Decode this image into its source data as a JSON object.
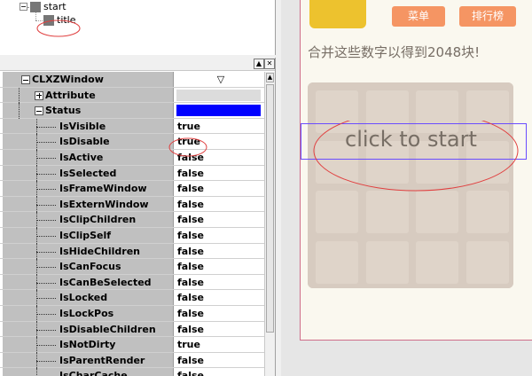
{
  "tree": {
    "root_label": "start",
    "child_label": "title"
  },
  "grid": {
    "toolbar_buttons": [
      "▲",
      "✕"
    ],
    "header_value_symbol": "▽",
    "attribute_color": "#dcdcdc",
    "status_color": "#0000ff",
    "rows": [
      {
        "name": "CLXZWindow",
        "value": "▽",
        "level": 0,
        "expander": "minus"
      },
      {
        "name": "Attribute",
        "value": "",
        "level": 1,
        "expander": "plus"
      },
      {
        "name": "Status",
        "value": "",
        "level": 1,
        "expander": "minus"
      },
      {
        "name": "IsVisible",
        "value": "true",
        "level": 2
      },
      {
        "name": "IsDisable",
        "value": "true",
        "level": 2
      },
      {
        "name": "IsActive",
        "value": "false",
        "level": 2
      },
      {
        "name": "IsSelected",
        "value": "false",
        "level": 2
      },
      {
        "name": "IsFrameWindow",
        "value": "false",
        "level": 2
      },
      {
        "name": "IsExternWindow",
        "value": "false",
        "level": 2
      },
      {
        "name": "IsClipChildren",
        "value": "false",
        "level": 2
      },
      {
        "name": "IsClipSelf",
        "value": "false",
        "level": 2
      },
      {
        "name": "IsHideChildren",
        "value": "false",
        "level": 2
      },
      {
        "name": "IsCanFocus",
        "value": "false",
        "level": 2
      },
      {
        "name": "IsCanBeSelected",
        "value": "false",
        "level": 2
      },
      {
        "name": "IsLocked",
        "value": "false",
        "level": 2
      },
      {
        "name": "IsLockPos",
        "value": "false",
        "level": 2
      },
      {
        "name": "IsDisableChildren",
        "value": "false",
        "level": 2
      },
      {
        "name": "IsNotDirty",
        "value": "true",
        "level": 2
      },
      {
        "name": "IsParentRender",
        "value": "false",
        "level": 2
      },
      {
        "name": "IsCharCache",
        "value": "false",
        "level": 2
      }
    ]
  },
  "game": {
    "menu_label": "菜单",
    "leaderboard_label": "排行榜",
    "tagline": "合并这些数字以得到2048块!",
    "click_to_start": "click to start",
    "colors": {
      "background": "#faf8ef",
      "logo": "#edc22e",
      "button": "#f59563",
      "board": "#bbada0",
      "empty_tile": "#cdc1b4",
      "text": "#776e65"
    },
    "board_size": 4
  },
  "annotations": {
    "circle_color": "#e04040",
    "selection_box_color": "#6a4cff"
  }
}
